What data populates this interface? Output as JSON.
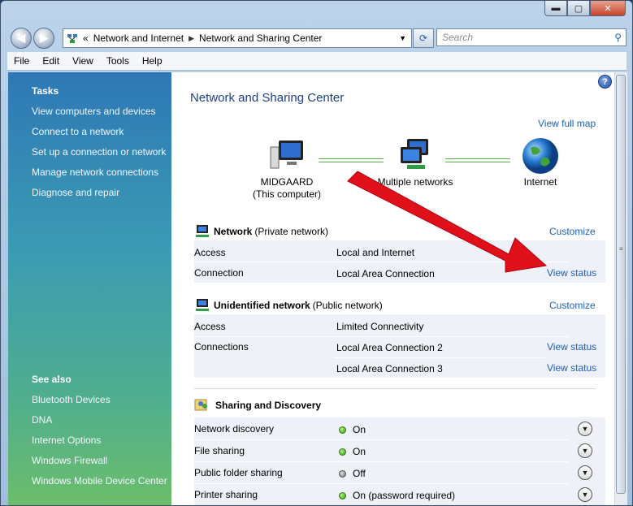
{
  "window": {
    "caption_buttons": [
      "minimize-icon",
      "maximize-icon",
      "close-icon"
    ]
  },
  "navbar": {
    "back_icon": "back-arrow-icon",
    "forward_icon": "forward-arrow-icon",
    "breadcrumb_prefix": "«",
    "breadcrumb": [
      "Network and Internet",
      "Network and Sharing Center"
    ],
    "search_placeholder": "Search"
  },
  "menu": [
    "File",
    "Edit",
    "View",
    "Tools",
    "Help"
  ],
  "sidebar": {
    "tasks_heading": "Tasks",
    "tasks": [
      "View computers and devices",
      "Connect to a network",
      "Set up a connection or network",
      "Manage network connections",
      "Diagnose and repair"
    ],
    "see_also_heading": "See also",
    "see_also": [
      "Bluetooth Devices",
      "DNA",
      "Internet Options",
      "Windows Firewall",
      "Windows Mobile Device Center"
    ]
  },
  "main": {
    "help_label": "?",
    "title": "Network and Sharing Center",
    "view_full_map": "View full map",
    "map": {
      "computer_name": "MIDGAARD",
      "computer_sub": "(This computer)",
      "networks": "Multiple networks",
      "internet": "Internet"
    },
    "network1": {
      "name": "Network",
      "type": "(Private network)",
      "customize": "Customize",
      "rows": [
        {
          "label": "Access",
          "value": "Local and Internet",
          "link": ""
        },
        {
          "label": "Connection",
          "value": "Local Area Connection",
          "link": "View status"
        }
      ]
    },
    "network2": {
      "name": "Unidentified network",
      "type": "(Public network)",
      "customize": "Customize",
      "rows": [
        {
          "label": "Access",
          "value": "Limited Connectivity",
          "link": ""
        },
        {
          "label": "Connections",
          "value": "Local Area Connection 2",
          "link": "View status"
        },
        {
          "label": "",
          "value": "Local Area Connection 3",
          "link": "View status"
        }
      ]
    },
    "sharing": {
      "heading": "Sharing and Discovery",
      "rows": [
        {
          "label": "Network discovery",
          "status": "On",
          "color": "green"
        },
        {
          "label": "File sharing",
          "status": "On",
          "color": "green"
        },
        {
          "label": "Public folder sharing",
          "status": "Off",
          "color": "gray"
        },
        {
          "label": "Printer sharing",
          "status": "On (password required)",
          "color": "green"
        }
      ]
    }
  },
  "colors": {
    "link": "#2060b8",
    "title": "#1e3f8c",
    "arrow": "#e0101a"
  }
}
